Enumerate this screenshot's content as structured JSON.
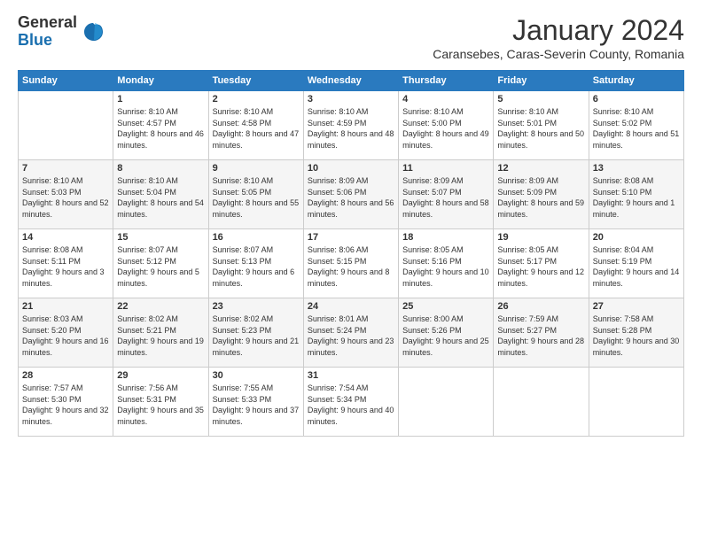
{
  "logo": {
    "general": "General",
    "blue": "Blue"
  },
  "header": {
    "month": "January 2024",
    "location": "Caransebes, Caras-Severin County, Romania"
  },
  "days_of_week": [
    "Sunday",
    "Monday",
    "Tuesday",
    "Wednesday",
    "Thursday",
    "Friday",
    "Saturday"
  ],
  "weeks": [
    [
      {
        "num": "",
        "sunrise": "",
        "sunset": "",
        "daylight": ""
      },
      {
        "num": "1",
        "sunrise": "Sunrise: 8:10 AM",
        "sunset": "Sunset: 4:57 PM",
        "daylight": "Daylight: 8 hours and 46 minutes."
      },
      {
        "num": "2",
        "sunrise": "Sunrise: 8:10 AM",
        "sunset": "Sunset: 4:58 PM",
        "daylight": "Daylight: 8 hours and 47 minutes."
      },
      {
        "num": "3",
        "sunrise": "Sunrise: 8:10 AM",
        "sunset": "Sunset: 4:59 PM",
        "daylight": "Daylight: 8 hours and 48 minutes."
      },
      {
        "num": "4",
        "sunrise": "Sunrise: 8:10 AM",
        "sunset": "Sunset: 5:00 PM",
        "daylight": "Daylight: 8 hours and 49 minutes."
      },
      {
        "num": "5",
        "sunrise": "Sunrise: 8:10 AM",
        "sunset": "Sunset: 5:01 PM",
        "daylight": "Daylight: 8 hours and 50 minutes."
      },
      {
        "num": "6",
        "sunrise": "Sunrise: 8:10 AM",
        "sunset": "Sunset: 5:02 PM",
        "daylight": "Daylight: 8 hours and 51 minutes."
      }
    ],
    [
      {
        "num": "7",
        "sunrise": "Sunrise: 8:10 AM",
        "sunset": "Sunset: 5:03 PM",
        "daylight": "Daylight: 8 hours and 52 minutes."
      },
      {
        "num": "8",
        "sunrise": "Sunrise: 8:10 AM",
        "sunset": "Sunset: 5:04 PM",
        "daylight": "Daylight: 8 hours and 54 minutes."
      },
      {
        "num": "9",
        "sunrise": "Sunrise: 8:10 AM",
        "sunset": "Sunset: 5:05 PM",
        "daylight": "Daylight: 8 hours and 55 minutes."
      },
      {
        "num": "10",
        "sunrise": "Sunrise: 8:09 AM",
        "sunset": "Sunset: 5:06 PM",
        "daylight": "Daylight: 8 hours and 56 minutes."
      },
      {
        "num": "11",
        "sunrise": "Sunrise: 8:09 AM",
        "sunset": "Sunset: 5:07 PM",
        "daylight": "Daylight: 8 hours and 58 minutes."
      },
      {
        "num": "12",
        "sunrise": "Sunrise: 8:09 AM",
        "sunset": "Sunset: 5:09 PM",
        "daylight": "Daylight: 8 hours and 59 minutes."
      },
      {
        "num": "13",
        "sunrise": "Sunrise: 8:08 AM",
        "sunset": "Sunset: 5:10 PM",
        "daylight": "Daylight: 9 hours and 1 minute."
      }
    ],
    [
      {
        "num": "14",
        "sunrise": "Sunrise: 8:08 AM",
        "sunset": "Sunset: 5:11 PM",
        "daylight": "Daylight: 9 hours and 3 minutes."
      },
      {
        "num": "15",
        "sunrise": "Sunrise: 8:07 AM",
        "sunset": "Sunset: 5:12 PM",
        "daylight": "Daylight: 9 hours and 5 minutes."
      },
      {
        "num": "16",
        "sunrise": "Sunrise: 8:07 AM",
        "sunset": "Sunset: 5:13 PM",
        "daylight": "Daylight: 9 hours and 6 minutes."
      },
      {
        "num": "17",
        "sunrise": "Sunrise: 8:06 AM",
        "sunset": "Sunset: 5:15 PM",
        "daylight": "Daylight: 9 hours and 8 minutes."
      },
      {
        "num": "18",
        "sunrise": "Sunrise: 8:05 AM",
        "sunset": "Sunset: 5:16 PM",
        "daylight": "Daylight: 9 hours and 10 minutes."
      },
      {
        "num": "19",
        "sunrise": "Sunrise: 8:05 AM",
        "sunset": "Sunset: 5:17 PM",
        "daylight": "Daylight: 9 hours and 12 minutes."
      },
      {
        "num": "20",
        "sunrise": "Sunrise: 8:04 AM",
        "sunset": "Sunset: 5:19 PM",
        "daylight": "Daylight: 9 hours and 14 minutes."
      }
    ],
    [
      {
        "num": "21",
        "sunrise": "Sunrise: 8:03 AM",
        "sunset": "Sunset: 5:20 PM",
        "daylight": "Daylight: 9 hours and 16 minutes."
      },
      {
        "num": "22",
        "sunrise": "Sunrise: 8:02 AM",
        "sunset": "Sunset: 5:21 PM",
        "daylight": "Daylight: 9 hours and 19 minutes."
      },
      {
        "num": "23",
        "sunrise": "Sunrise: 8:02 AM",
        "sunset": "Sunset: 5:23 PM",
        "daylight": "Daylight: 9 hours and 21 minutes."
      },
      {
        "num": "24",
        "sunrise": "Sunrise: 8:01 AM",
        "sunset": "Sunset: 5:24 PM",
        "daylight": "Daylight: 9 hours and 23 minutes."
      },
      {
        "num": "25",
        "sunrise": "Sunrise: 8:00 AM",
        "sunset": "Sunset: 5:26 PM",
        "daylight": "Daylight: 9 hours and 25 minutes."
      },
      {
        "num": "26",
        "sunrise": "Sunrise: 7:59 AM",
        "sunset": "Sunset: 5:27 PM",
        "daylight": "Daylight: 9 hours and 28 minutes."
      },
      {
        "num": "27",
        "sunrise": "Sunrise: 7:58 AM",
        "sunset": "Sunset: 5:28 PM",
        "daylight": "Daylight: 9 hours and 30 minutes."
      }
    ],
    [
      {
        "num": "28",
        "sunrise": "Sunrise: 7:57 AM",
        "sunset": "Sunset: 5:30 PM",
        "daylight": "Daylight: 9 hours and 32 minutes."
      },
      {
        "num": "29",
        "sunrise": "Sunrise: 7:56 AM",
        "sunset": "Sunset: 5:31 PM",
        "daylight": "Daylight: 9 hours and 35 minutes."
      },
      {
        "num": "30",
        "sunrise": "Sunrise: 7:55 AM",
        "sunset": "Sunset: 5:33 PM",
        "daylight": "Daylight: 9 hours and 37 minutes."
      },
      {
        "num": "31",
        "sunrise": "Sunrise: 7:54 AM",
        "sunset": "Sunset: 5:34 PM",
        "daylight": "Daylight: 9 hours and 40 minutes."
      },
      {
        "num": "",
        "sunrise": "",
        "sunset": "",
        "daylight": ""
      },
      {
        "num": "",
        "sunrise": "",
        "sunset": "",
        "daylight": ""
      },
      {
        "num": "",
        "sunrise": "",
        "sunset": "",
        "daylight": ""
      }
    ]
  ]
}
